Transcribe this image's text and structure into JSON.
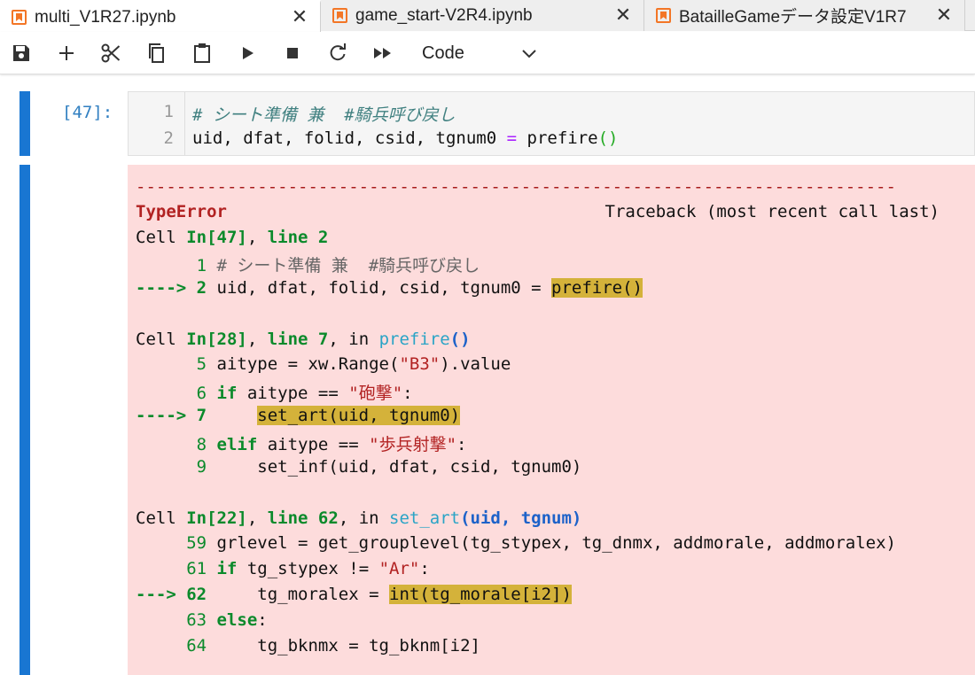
{
  "tabs": [
    {
      "label": "multi_V1R27.ipynb",
      "active": true
    },
    {
      "label": "game_start-V2R4.ipynb",
      "active": false
    },
    {
      "label": "BatailleGameデータ設定V1R7",
      "active": false
    }
  ],
  "tab_close_glyph": "✕",
  "toolbar": {
    "icons": [
      "save-icon",
      "add-cell-icon",
      "cut-icon",
      "copy-icon",
      "paste-icon",
      "run-icon",
      "stop-icon",
      "restart-icon",
      "fast-forward-icon"
    ],
    "cell_type": "Code"
  },
  "colors": {
    "accent": "#1976d2",
    "error_bg": "#fddcdc",
    "highlight": "#d4b23a",
    "tab_icon": "#f37626"
  },
  "cell": {
    "prompt": "[47]:",
    "lines": [
      {
        "num": "1",
        "comment": "# シート準備 兼  #騎兵呼び戻し"
      },
      {
        "num": "2",
        "lhs": "uid, dfat, folid, csid, tgnum0 ",
        "op": "=",
        "fn": " prefire",
        "paren": "()"
      }
    ]
  },
  "traceback": {
    "dash_line": "---------------------------------------------------------------------------",
    "error_type": "TypeError",
    "traceback_header": "Traceback (most recent call last)",
    "frames": [
      {
        "cell_prefix": "Cell ",
        "cell_in": "In[47]",
        "comma": ", ",
        "line_label": "line 2",
        "in_text": "",
        "fn_name": "",
        "fn_args": "",
        "lines": [
          {
            "arrow": "      ",
            "num": "1",
            "text": " # シート準備 兼  #騎兵呼び戻し"
          },
          {
            "arrow": "----> ",
            "num": "2",
            "text": " uid, dfat, folid, csid, tgnum0 = ",
            "hl": "prefire()"
          }
        ]
      },
      {
        "cell_prefix": "Cell ",
        "cell_in": "In[28]",
        "comma": ", ",
        "line_label": "line 7",
        "in_text": ", in ",
        "fn_name": "prefire",
        "fn_args": "()",
        "lines": [
          {
            "arrow": "      ",
            "num": "5",
            "text": " aitype = xw.Range(",
            "str": "\"B3\"",
            "tail": ").value"
          },
          {
            "arrow": "      ",
            "num": "6",
            "kw": " if",
            "text": " aitype == ",
            "str": "\"砲撃\"",
            "tail": ":"
          },
          {
            "arrow": "----> ",
            "num": "7",
            "text": "     ",
            "hl": "set_art(uid, tgnum0)"
          },
          {
            "arrow": "      ",
            "num": "8",
            "kw": " elif",
            "text": " aitype == ",
            "str": "\"歩兵射撃\"",
            "tail": ":"
          },
          {
            "arrow": "      ",
            "num": "9",
            "text": "     set_inf(uid, dfat, csid, tgnum0)"
          }
        ]
      },
      {
        "cell_prefix": "Cell ",
        "cell_in": "In[22]",
        "comma": ", ",
        "line_label": "line 62",
        "in_text": ", in ",
        "fn_name": "set_art",
        "fn_args": "(uid, tgnum)",
        "lines": [
          {
            "arrow": "     ",
            "num": "59",
            "text": " grlevel = get_grouplevel(tg_stypex, tg_dnmx, addmorale, addmoralex)"
          },
          {
            "arrow": "     ",
            "num": "61",
            "kw": " if",
            "text": " tg_stypex != ",
            "str": "\"Ar\"",
            "tail": ":"
          },
          {
            "arrow": "---> ",
            "num": "62",
            "text": "     tg_moralex = ",
            "hl": "int(tg_morale[i2])"
          },
          {
            "arrow": "     ",
            "num": "63",
            "kw": " else",
            "text": "",
            "tail": ":"
          },
          {
            "arrow": "     ",
            "num": "64",
            "text": "     tg_bknmx = tg_bknm[i2]"
          }
        ]
      }
    ]
  }
}
